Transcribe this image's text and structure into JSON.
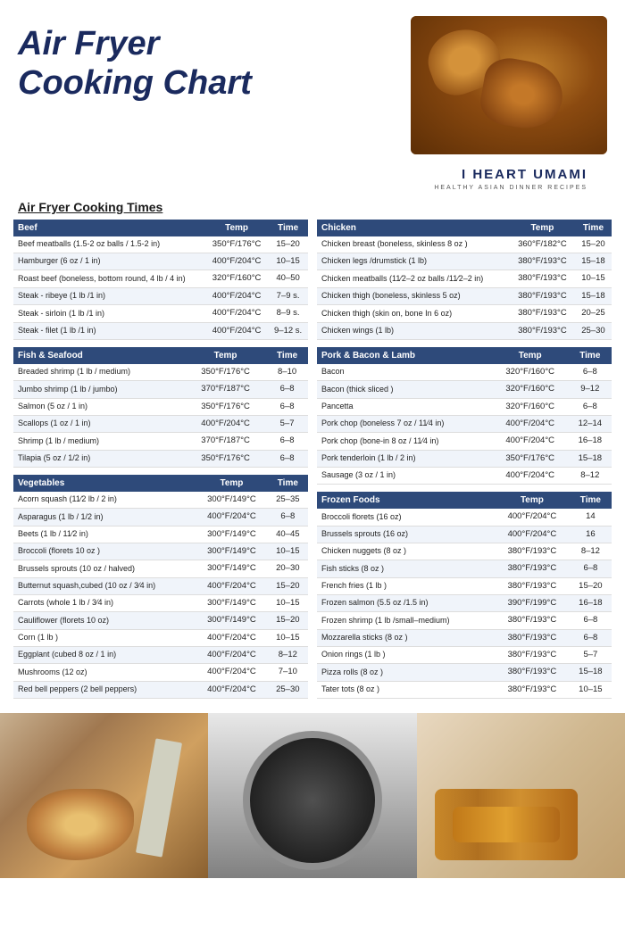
{
  "header": {
    "title": "Air Fryer\nCooking Chart"
  },
  "brand": {
    "name": "I HEART UMAMI",
    "tagline": "HEALTHY ASIAN DINNER RECIPES"
  },
  "section_title": "Air Fryer Cooking Times",
  "tables": {
    "beef": {
      "category": "Beef",
      "col_temp": "Temp",
      "col_time": "Time",
      "rows": [
        [
          "Beef meatballs (1.5-2 oz balls / 1.5-2 in)",
          "350°F/176°C",
          "15–20"
        ],
        [
          "Hamburger (6 oz / 1 in)",
          "400°F/204°C",
          "10–15"
        ],
        [
          "Roast beef (boneless, bottom round, 4 lb / 4 in)",
          "320°F/160°C",
          "40–50"
        ],
        [
          "Steak - ribeye (1 lb /1 in)",
          "400°F/204°C",
          "7–9 s."
        ],
        [
          "Steak - sirloin (1 lb /1 in)",
          "400°F/204°C",
          "8–9 s."
        ],
        [
          "Steak - filet (1 lb /1 in)",
          "400°F/204°C",
          "9–12 s."
        ]
      ]
    },
    "fish": {
      "category": "Fish & Seafood",
      "col_temp": "Temp",
      "col_time": "Time",
      "rows": [
        [
          "Breaded shrimp (1 lb / medium)",
          "350°F/176°C",
          "8–10"
        ],
        [
          "Jumbo shrimp (1 lb / jumbo)",
          "370°F/187°C",
          "6–8"
        ],
        [
          "Salmon (5 oz / 1 in)",
          "350°F/176°C",
          "6–8"
        ],
        [
          "Scallops (1 oz / 1 in)",
          "400°F/204°C",
          "5–7"
        ],
        [
          "Shrimp (1 lb / medium)",
          "370°F/187°C",
          "6–8"
        ],
        [
          "Tilapia (5 oz / 1/2 in)",
          "350°F/176°C",
          "6–8"
        ]
      ]
    },
    "vegetables": {
      "category": "Vegetables",
      "col_temp": "Temp",
      "col_time": "Time",
      "rows": [
        [
          "Acorn squash (11⁄2 lb / 2 in)",
          "300°F/149°C",
          "25–35"
        ],
        [
          "Asparagus (1 lb / 1/2 in)",
          "400°F/204°C",
          "6–8"
        ],
        [
          "Beets (1 lb / 11⁄2 in)",
          "300°F/149°C",
          "40–45"
        ],
        [
          "Broccoli (florets 10 oz )",
          "300°F/149°C",
          "10–15"
        ],
        [
          "Brussels sprouts (10 oz / halved)",
          "300°F/149°C",
          "20–30"
        ],
        [
          "Butternut squash,cubed (10 oz / 3⁄4 in)",
          "400°F/204°C",
          "15–20"
        ],
        [
          "Carrots (whole 1 lb / 3⁄4 in)",
          "300°F/149°C",
          "10–15"
        ],
        [
          "Cauliflower (florets 10 oz)",
          "300°F/149°C",
          "15–20"
        ],
        [
          "Corn (1 lb )",
          "400°F/204°C",
          "10–15"
        ],
        [
          "Eggplant (cubed 8 oz / 1 in)",
          "400°F/204°C",
          "8–12"
        ],
        [
          "Mushrooms (12 oz)",
          "400°F/204°C",
          "7–10"
        ],
        [
          "Red bell peppers (2 bell peppers)",
          "400°F/204°C",
          "25–30"
        ]
      ]
    },
    "chicken": {
      "category": "Chicken",
      "col_temp": "Temp",
      "col_time": "Time",
      "rows": [
        [
          "Chicken breast (boneless, skinless 8 oz )",
          "360°F/182°C",
          "15–20"
        ],
        [
          "Chicken legs /drumstick (1 lb)",
          "380°F/193°C",
          "15–18"
        ],
        [
          "Chicken meatballs (11⁄2–2 oz balls /11⁄2–2 in)",
          "380°F/193°C",
          "10–15"
        ],
        [
          "Chicken thigh (boneless, skinless 5 oz)",
          "380°F/193°C",
          "15–18"
        ],
        [
          "Chicken thigh (skin on, bone In 6 oz)",
          "380°F/193°C",
          "20–25"
        ],
        [
          "Chicken wings (1 lb)",
          "380°F/193°C",
          "25–30"
        ]
      ]
    },
    "pork": {
      "category": "Pork & Bacon & Lamb",
      "col_temp": "Temp",
      "col_time": "Time",
      "rows": [
        [
          "Bacon",
          "320°F/160°C",
          "6–8"
        ],
        [
          "Bacon (thick sliced )",
          "320°F/160°C",
          "9–12"
        ],
        [
          "Pancetta",
          "320°F/160°C",
          "6–8"
        ],
        [
          "Pork chop (boneless 7 oz / 11⁄4 in)",
          "400°F/204°C",
          "12–14"
        ],
        [
          "Pork chop (bone-in 8 oz / 11⁄4 in)",
          "400°F/204°C",
          "16–18"
        ],
        [
          "Pork tenderloin (1 lb / 2 in)",
          "350°F/176°C",
          "15–18"
        ],
        [
          "Sausage (3 oz / 1 in)",
          "400°F/204°C",
          "8–12"
        ]
      ]
    },
    "frozen": {
      "category": "Frozen Foods",
      "col_temp": "Temp",
      "col_time": "Time",
      "rows": [
        [
          "Broccoli florets (16 oz)",
          "400°F/204°C",
          "14"
        ],
        [
          "Brussels sprouts (16 oz)",
          "400°F/204°C",
          "16"
        ],
        [
          "Chicken nuggets (8 oz )",
          "380°F/193°C",
          "8–12"
        ],
        [
          "Fish sticks (8 oz )",
          "380°F/193°C",
          "6–8"
        ],
        [
          "French fries (1 lb )",
          "380°F/193°C",
          "15–20"
        ],
        [
          "Frozen salmon (5.5 oz /1.5 in)",
          "390°F/199°C",
          "16–18"
        ],
        [
          "Frozen shrimp (1 lb /small–medium)",
          "380°F/193°C",
          "6–8"
        ],
        [
          "Mozzarella sticks (8 oz )",
          "380°F/193°C",
          "6–8"
        ],
        [
          "Onion rings (1 lb )",
          "380°F/193°C",
          "5–7"
        ],
        [
          "Pizza rolls (8 oz )",
          "380°F/193°C",
          "15–18"
        ],
        [
          "Tater tots (8 oz )",
          "380°F/193°C",
          "10–15"
        ]
      ]
    }
  }
}
